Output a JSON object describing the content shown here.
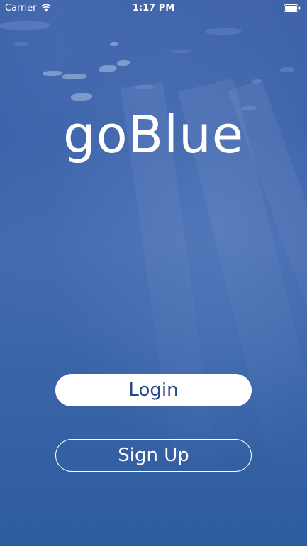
{
  "status_bar": {
    "carrier": "Carrier",
    "time": "1:17 PM",
    "wifi_icon": "wifi-icon",
    "battery_icon": "battery-icon"
  },
  "app": {
    "logo_text": "goBlue",
    "background_color": "#3a5fa6"
  },
  "actions": {
    "login_label": "Login",
    "signup_label": "Sign Up"
  }
}
